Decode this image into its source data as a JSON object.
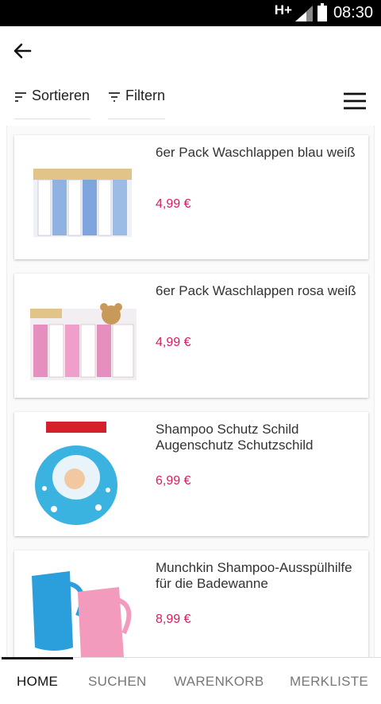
{
  "status_bar": {
    "network": "H+",
    "time": "08:30"
  },
  "toolbar": {
    "sort_label": "Sortieren",
    "filter_label": "Filtern"
  },
  "products": [
    {
      "title": "6er Pack Waschlappen blau weiß",
      "price": "4,99 €"
    },
    {
      "title": "6er Pack Waschlappen rosa weiß",
      "price": "4,99 €"
    },
    {
      "title": "Shampoo Schutz Schild Augenschutz Schutzschild",
      "price": "6,99 €"
    },
    {
      "title": "Munchkin Shampoo-Ausspülhilfe für die Badewanne",
      "price": "8,99 €"
    }
  ],
  "bottom_nav": {
    "home": "HOME",
    "search": "SUCHEN",
    "cart": "WARENKORB",
    "wishlist": "MERKLISTE"
  },
  "colors": {
    "price": "#d81b60",
    "status_bar": "#000000"
  }
}
